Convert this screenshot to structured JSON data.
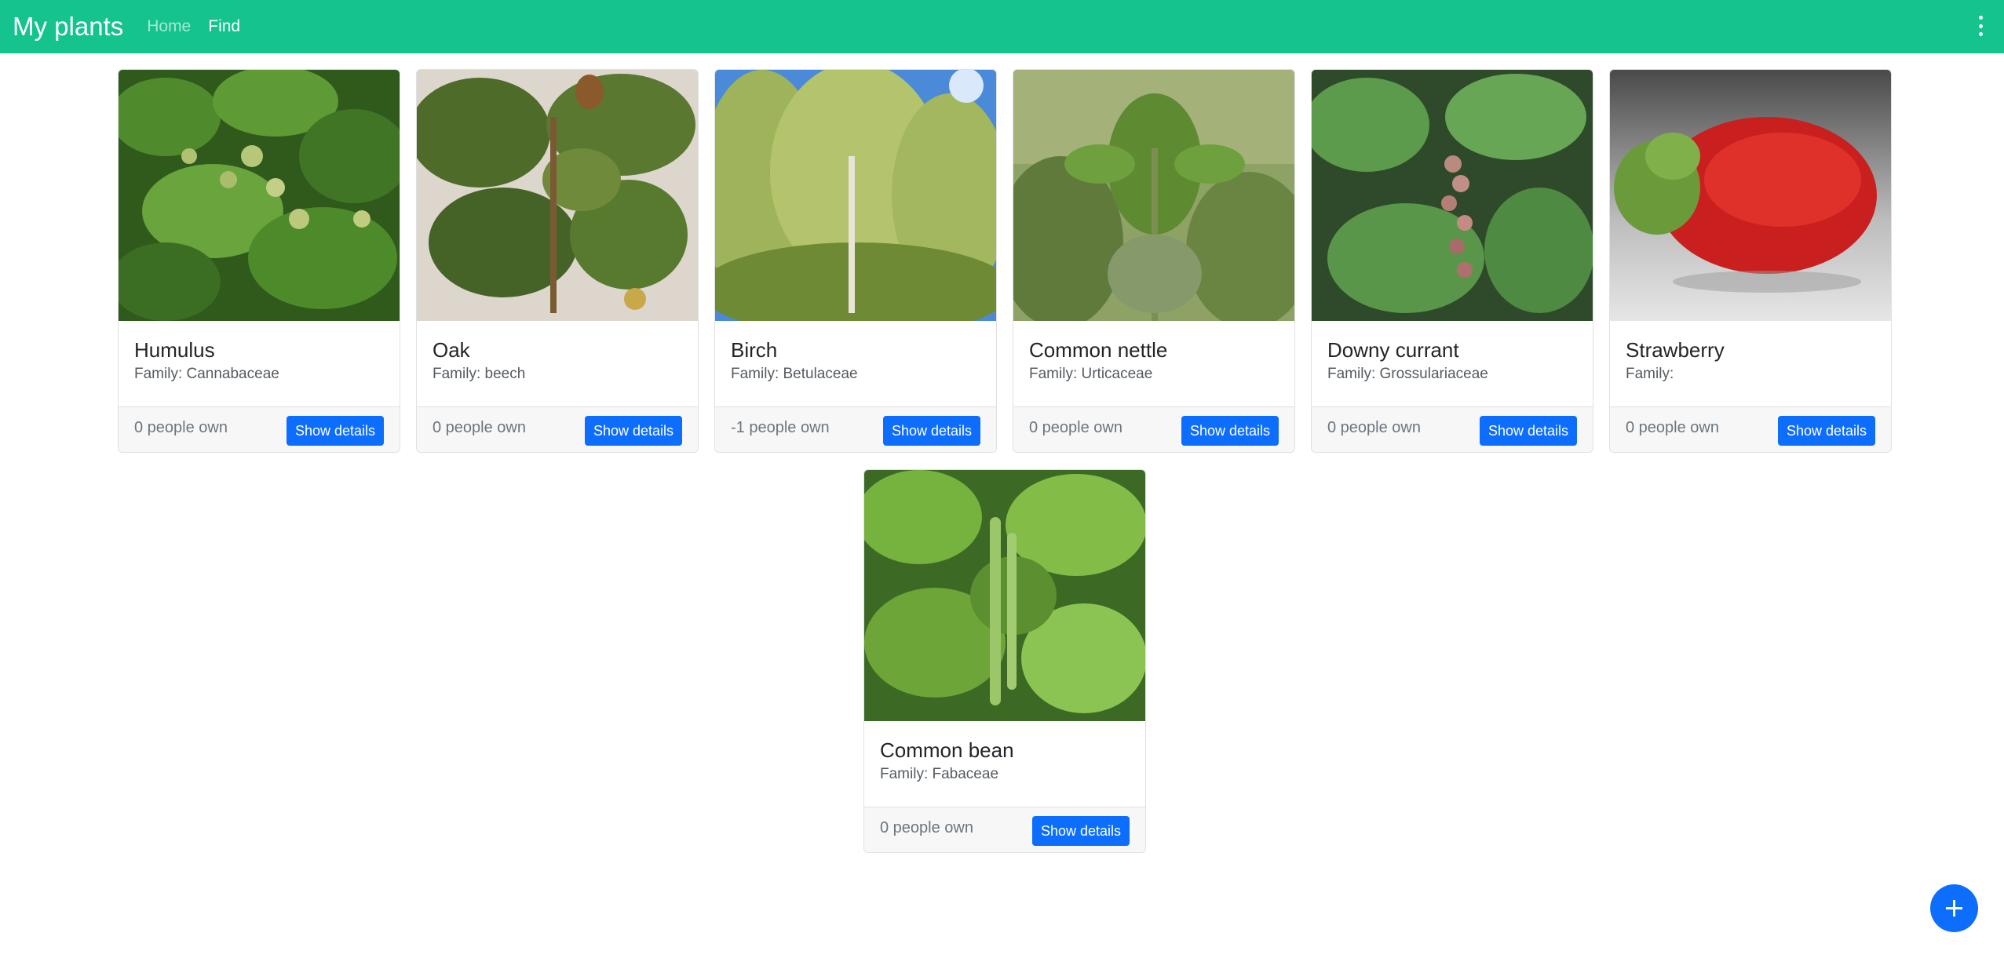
{
  "navbar": {
    "brand": "My plants",
    "links": [
      {
        "label": "Home",
        "active": false
      },
      {
        "label": "Find",
        "active": true
      }
    ],
    "menu_icon": "more-vertical-icon"
  },
  "cards": [
    {
      "name": "Humulus",
      "family": "Family: Cannabaceae",
      "owners": "0 people own",
      "button": "Show details",
      "image": "hop-plant-photo"
    },
    {
      "name": "Oak",
      "family": "Family: beech",
      "owners": "0 people own",
      "button": "Show details",
      "image": "oak-leaves-photo"
    },
    {
      "name": "Birch",
      "family": "Family: Betulaceae",
      "owners": "-1 people own",
      "button": "Show details",
      "image": "birch-tree-photo"
    },
    {
      "name": "Common nettle",
      "family": "Family: Urticaceae",
      "owners": "0 people own",
      "button": "Show details",
      "image": "nettle-photo"
    },
    {
      "name": "Downy currant",
      "family": "Family: Grossulariaceae",
      "owners": "0 people own",
      "button": "Show details",
      "image": "currant-photo"
    },
    {
      "name": "Strawberry",
      "family": "Family:",
      "owners": "0 people own",
      "button": "Show details",
      "image": "strawberry-photo"
    },
    {
      "name": "Common bean",
      "family": "Family: Fabaceae",
      "owners": "0 people own",
      "button": "Show details",
      "image": "bean-plant-photo"
    }
  ],
  "fab": {
    "icon": "plus-icon"
  },
  "colors": {
    "navbar": "#14c38e",
    "primary": "#0d6efd",
    "footer": "#f7f7f7"
  }
}
